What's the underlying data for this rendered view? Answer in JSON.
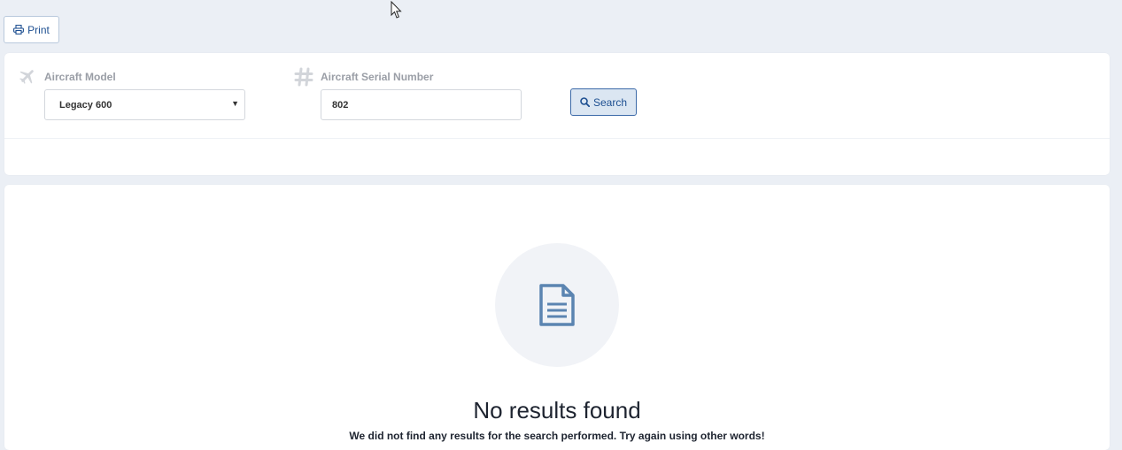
{
  "toolbar": {
    "print_label": "Print"
  },
  "filters": {
    "model": {
      "label": "Aircraft Model",
      "selected": "Legacy 600"
    },
    "serial": {
      "label": "Aircraft Serial Number",
      "value": "802"
    },
    "search_label": "Search"
  },
  "results": {
    "empty_title": "No results found",
    "empty_message": "We did not find any results for the search performed. Try again using other words!"
  },
  "colors": {
    "background": "#ebeff5",
    "accent": "#1d4f91",
    "icon": "#5b84b1"
  }
}
